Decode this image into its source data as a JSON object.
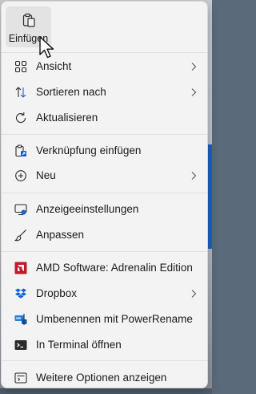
{
  "quick_actions": {
    "paste": {
      "label": "Einfügen",
      "icon": "clipboard-paste-icon"
    }
  },
  "items": [
    {
      "label": "Ansicht",
      "icon": "grid-view-icon",
      "submenu": true
    },
    {
      "label": "Sortieren nach",
      "icon": "sort-arrows-icon",
      "submenu": true
    },
    {
      "label": "Aktualisieren",
      "icon": "refresh-icon",
      "submenu": false
    },
    {
      "label": "Verknüpfung einfügen",
      "icon": "paste-shortcut-icon",
      "submenu": false
    },
    {
      "label": "Neu",
      "icon": "plus-circle-icon",
      "submenu": true
    },
    {
      "label": "Anzeigeeinstellungen",
      "icon": "display-icon",
      "submenu": false
    },
    {
      "label": "Anpassen",
      "icon": "paintbrush-icon",
      "submenu": false
    },
    {
      "label": "AMD Software: Adrenalin Edition",
      "icon": "amd-logo-icon",
      "submenu": false
    },
    {
      "label": "Dropbox",
      "icon": "dropbox-icon",
      "submenu": true
    },
    {
      "label": "Umbenennen mit PowerRename",
      "icon": "powerrename-icon",
      "submenu": false
    },
    {
      "label": "In Terminal öffnen",
      "icon": "terminal-icon",
      "submenu": false
    },
    {
      "label": "Weitere Optionen anzeigen",
      "icon": "more-options-icon",
      "submenu": false
    }
  ],
  "colors": {
    "menu_bg": "#f3f3f3",
    "amd_red": "#c4172c",
    "dropbox_blue": "#0b61d6",
    "accent_blue": "#1e5fc8"
  }
}
